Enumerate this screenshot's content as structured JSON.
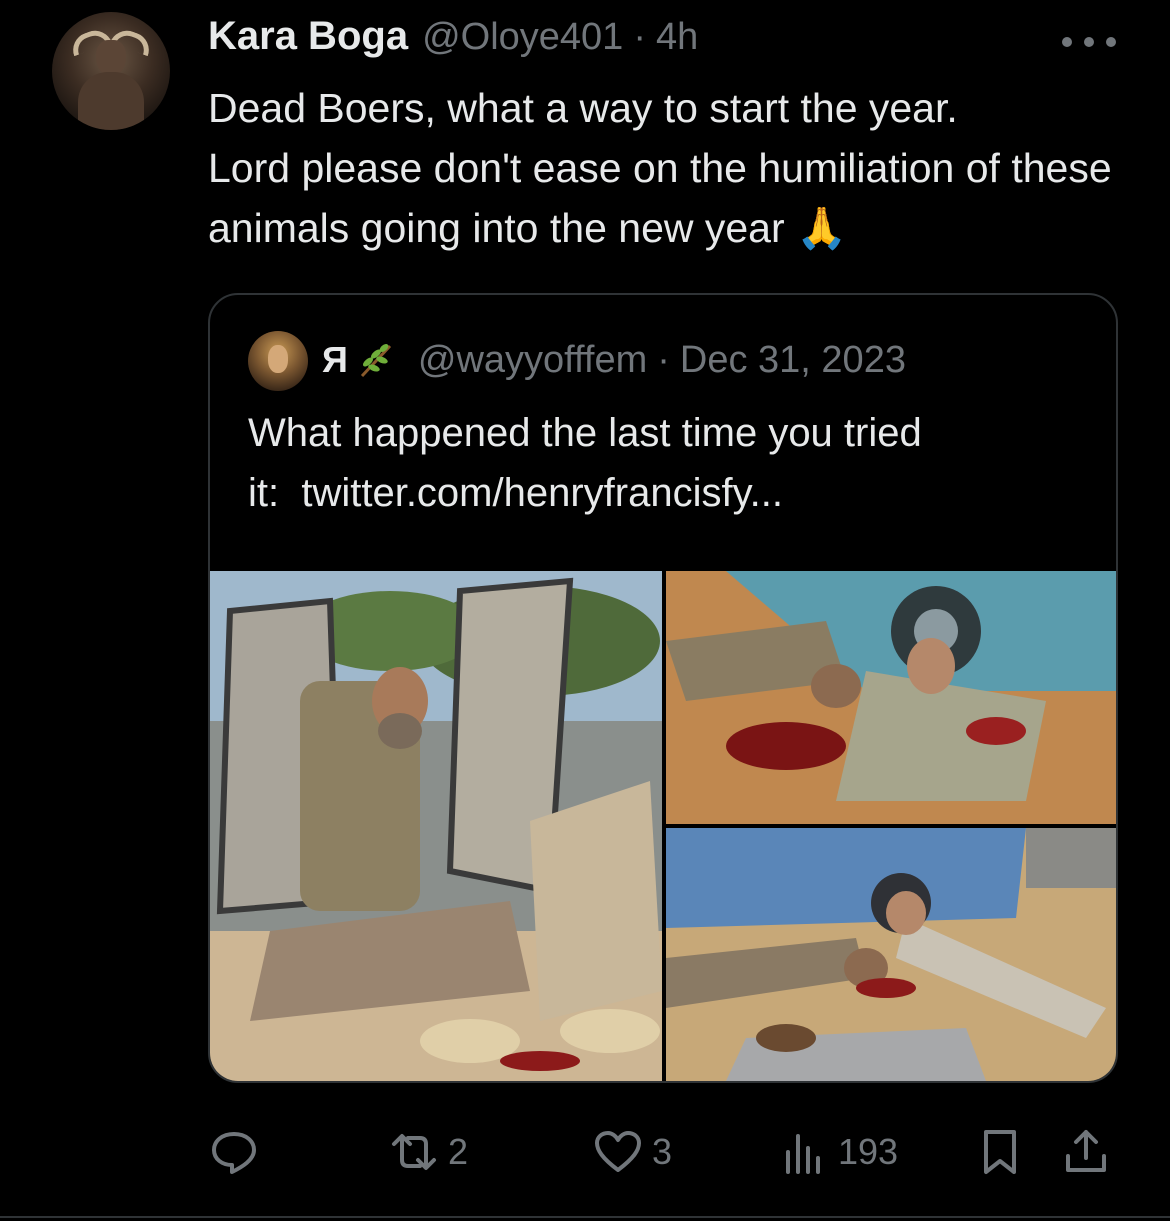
{
  "tweet": {
    "author_name": "Kara Boga",
    "author_handle": "@Oloye401",
    "separator": "·",
    "time": "4h",
    "text": "Dead Boers, what a way to start the year.\nLord please don't ease on the humiliation of these animals going into the new year 🙏",
    "more_icon": "more-horizontal-icon"
  },
  "quoted": {
    "author_name": "Я",
    "author_emoji": "herb-icon",
    "author_handle": "@wayyofffem",
    "separator": "·",
    "date": "Dec 31, 2023",
    "text": "What happened the last time you tried\nit:  twitter.com/henryfrancisfy...",
    "photo_count": 3
  },
  "actions": {
    "reply_icon": "reply-icon",
    "retweet_icon": "retweet-icon",
    "retweet_count": "2",
    "like_icon": "heart-icon",
    "like_count": "3",
    "views_icon": "views-bar-chart-icon",
    "views_count": "193",
    "bookmark_icon": "bookmark-icon",
    "share_icon": "share-icon"
  },
  "colors": {
    "background": "#000000",
    "primary_text": "#e7e9ea",
    "secondary_text": "#71767b",
    "border": "#2f3336"
  }
}
